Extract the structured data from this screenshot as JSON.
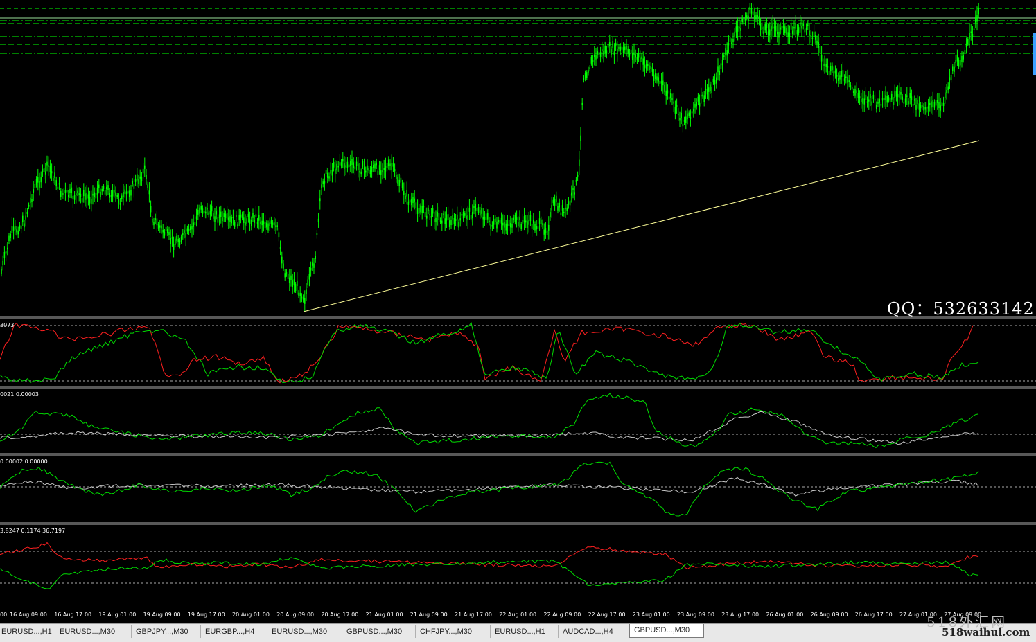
{
  "app": {
    "symbol_tab_active": "GBPUSD...,M30"
  },
  "colors": {
    "background": "#000000",
    "candle": "#00ff00",
    "trendline": "#ffff99",
    "level_line": "#00ff00",
    "series_red": "#ff2020",
    "series_green": "#00dd00",
    "series_white": "#c8c8c8"
  },
  "main_chart": {
    "watermark_text": "QQ：532633142"
  },
  "panels": [
    {
      "label": "3073"
    },
    {
      "label": "0021 0.00003"
    },
    {
      "label": "0.00002 0.00000"
    },
    {
      "label": "3.8247 0.1174 36.7197"
    }
  ],
  "time_axis": [
    "00",
    "16 Aug 09:00",
    "16 Aug 17:00",
    "19 Aug 01:00",
    "19 Aug 09:00",
    "19 Aug 17:00",
    "20 Aug 01:00",
    "20 Aug 09:00",
    "20 Aug 17:00",
    "21 Aug 01:00",
    "21 Aug 09:00",
    "21 Aug 17:00",
    "22 Aug 01:00",
    "22 Aug 09:00",
    "22 Aug 17:00",
    "23 Aug 01:00",
    "23 Aug 09:00",
    "23 Aug 17:00",
    "26 Aug 01:00",
    "26 Aug 09:00",
    "26 Aug 17:00",
    "27 Aug 01:00",
    "27 Aug 09:00"
  ],
  "tabs": [
    {
      "label": "EURUSD...,H1"
    },
    {
      "label": "EURUSD...,M30"
    },
    {
      "label": "GBPJPY...,M30"
    },
    {
      "label": "EURGBP...,H4"
    },
    {
      "label": "EURUSD...,M30"
    },
    {
      "label": "GBPUSD...,M30"
    },
    {
      "label": "CHFJPY...,M30"
    },
    {
      "label": "EURUSD...,H1"
    },
    {
      "label": "AUDCAD...,H4"
    },
    {
      "label": "GBPUSD...,M30"
    }
  ],
  "watermark_logo": {
    "logo": "518外汇网",
    "site": "518waihui.com"
  }
}
